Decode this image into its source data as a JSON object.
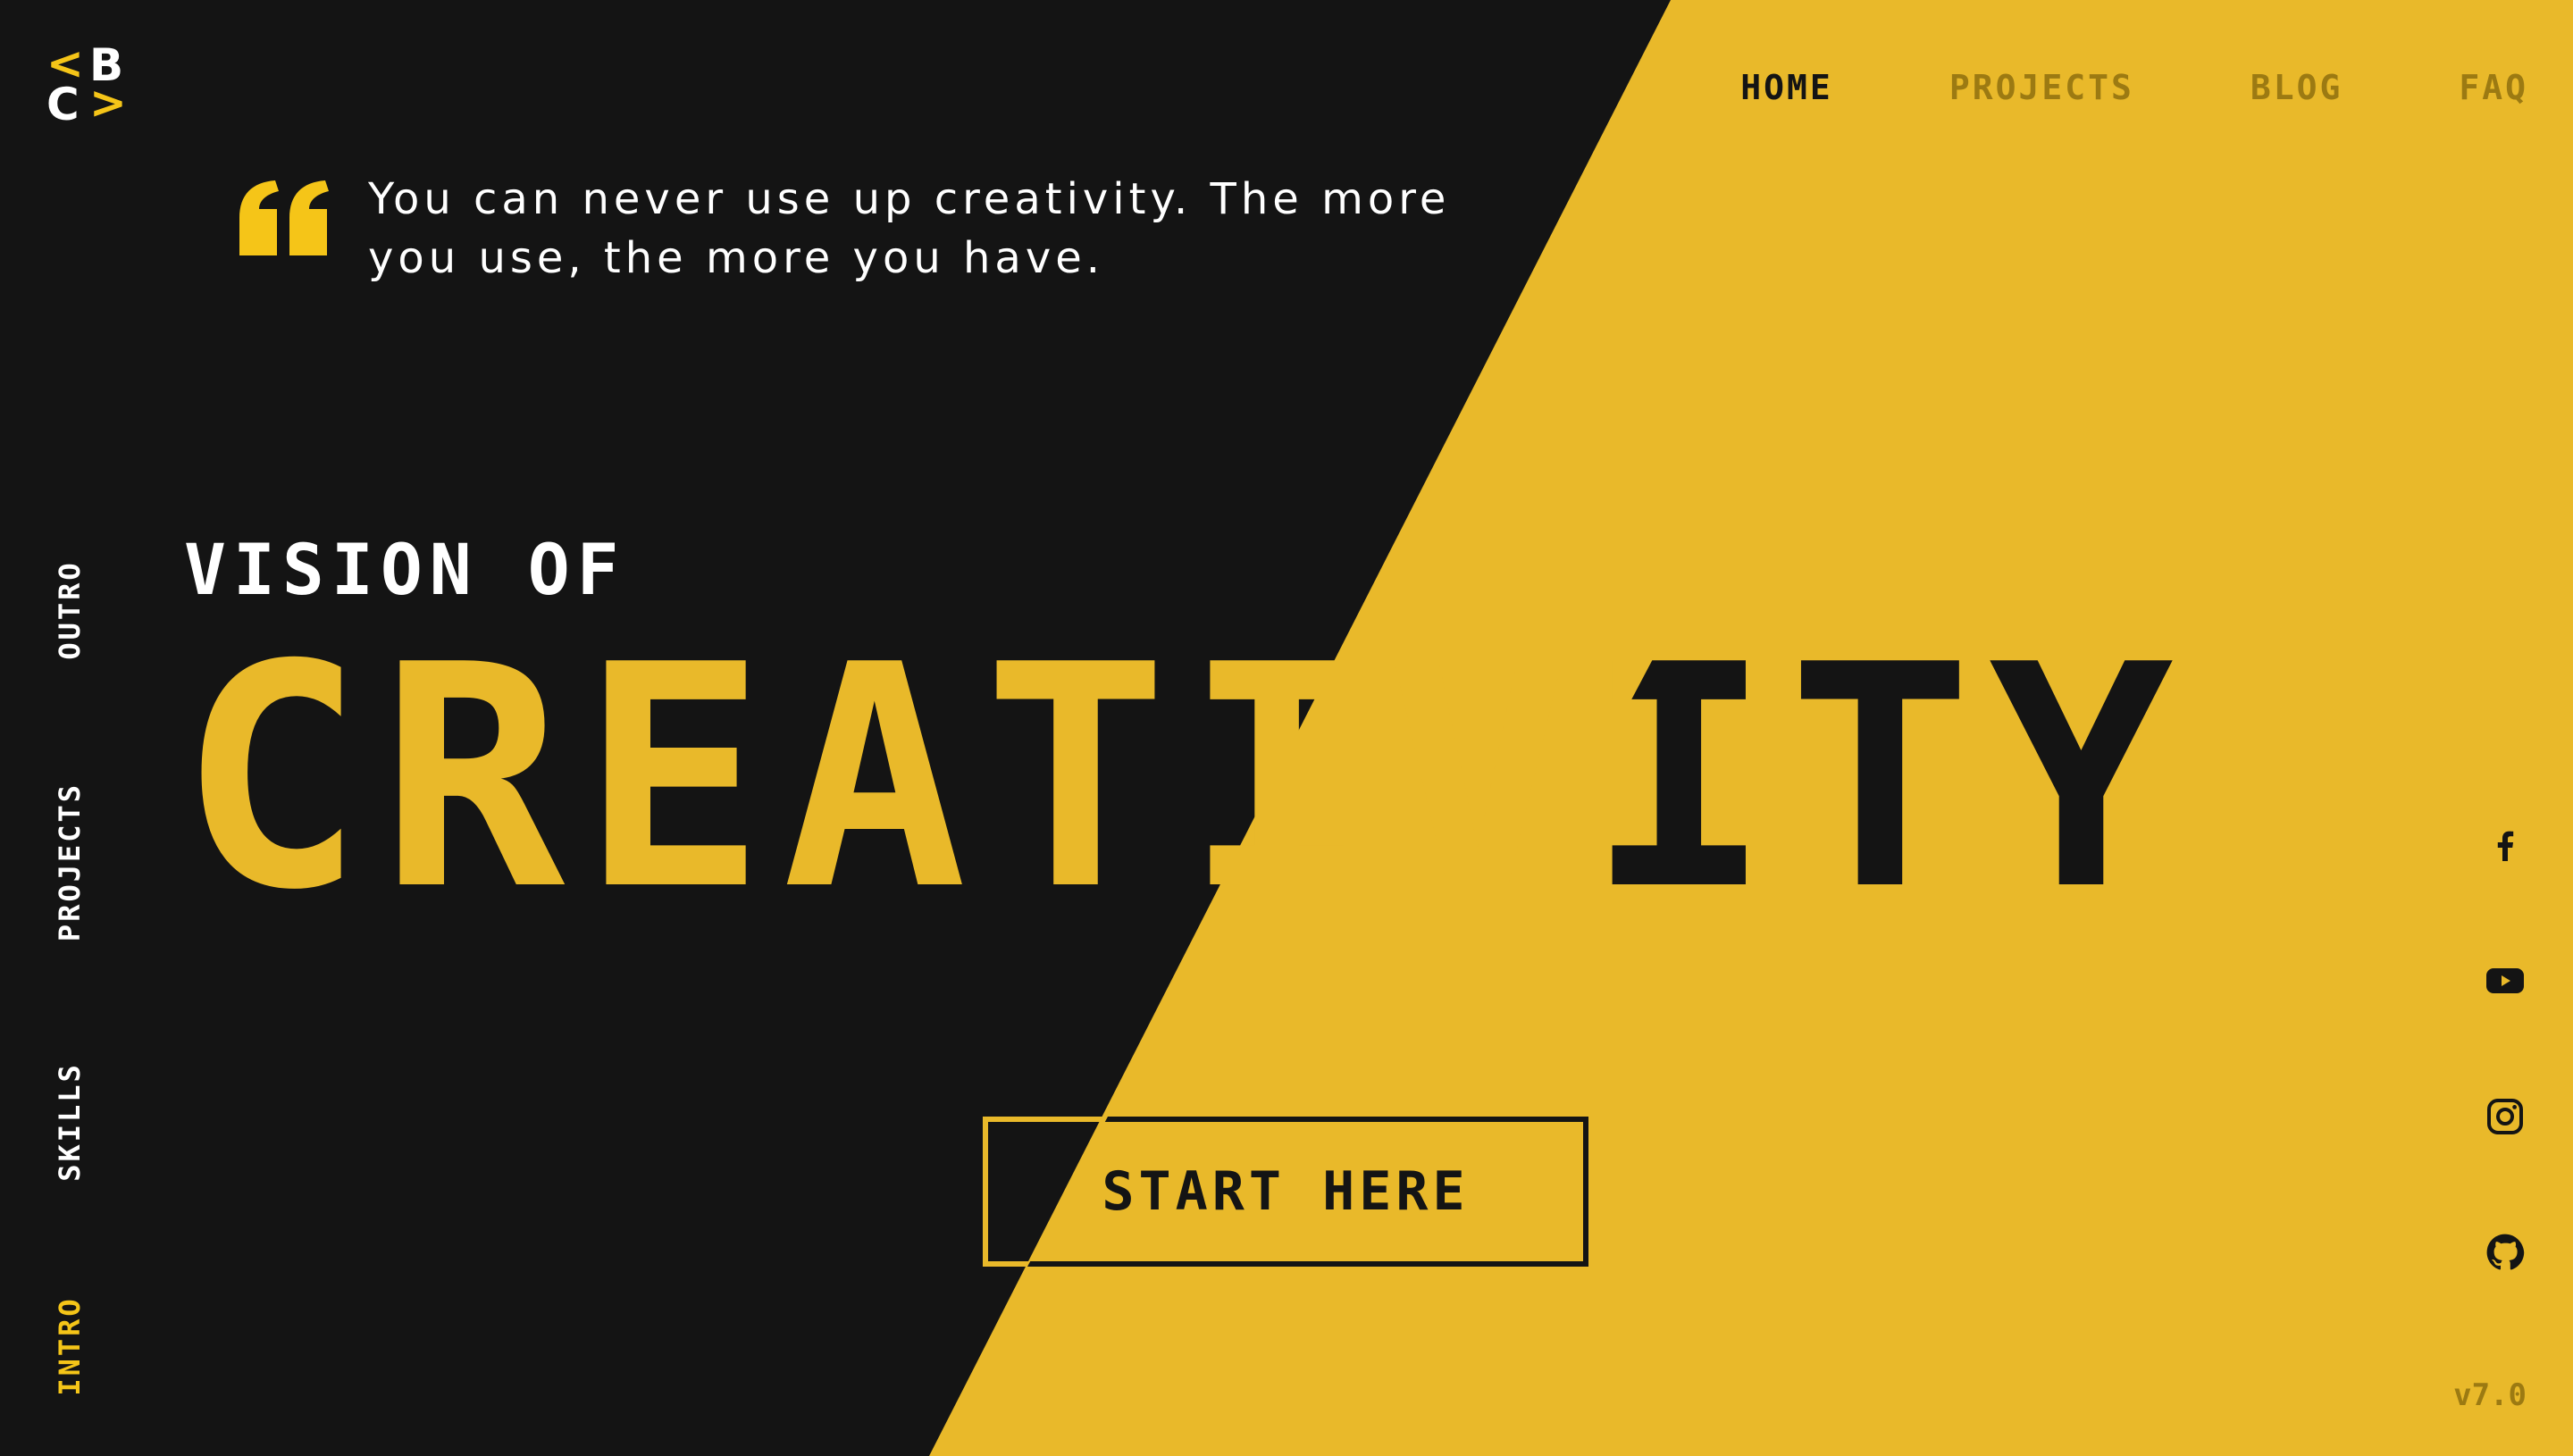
{
  "logo": {
    "top_left": "<",
    "top_right": "B",
    "bottom_left": "C",
    "bottom_right": ">"
  },
  "nav": {
    "items": [
      {
        "label": "HOME",
        "active": true
      },
      {
        "label": "PROJECTS",
        "active": false
      },
      {
        "label": "BLOG",
        "active": false
      },
      {
        "label": "FAQ",
        "active": false
      }
    ]
  },
  "quote": {
    "text": "You can never use up creativity. The more you use, the more you have."
  },
  "side_nav": {
    "items": [
      {
        "label": "OUTRO",
        "active": false
      },
      {
        "label": "PROJECTS",
        "active": false
      },
      {
        "label": "SKILLS",
        "active": false
      },
      {
        "label": "INTRO",
        "active": true
      }
    ]
  },
  "hero": {
    "kicker": "VISION OF",
    "headline": "CREATIVITY"
  },
  "cta": {
    "label": "START HERE"
  },
  "socials": [
    {
      "icon": "facebook-icon"
    },
    {
      "icon": "youtube-icon"
    },
    {
      "icon": "instagram-icon"
    },
    {
      "icon": "github-icon"
    }
  ],
  "version": "v7.0",
  "colors": {
    "dark": "#141414",
    "yellow": "#E9B92A",
    "accent": "#F5C518",
    "muted": "#9C7A12"
  }
}
